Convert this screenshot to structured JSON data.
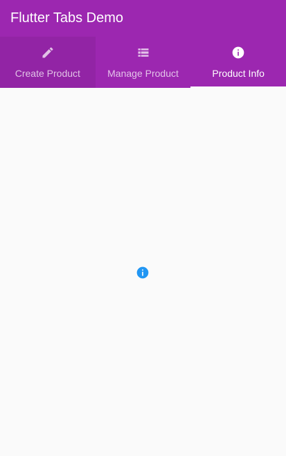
{
  "app": {
    "title": "Flutter Tabs Demo"
  },
  "tabs": [
    {
      "label": "Create Product",
      "icon": "pencil-icon",
      "selected": false
    },
    {
      "label": "Manage Product",
      "icon": "list-icon",
      "selected": false
    },
    {
      "label": "Product Info",
      "icon": "info-icon",
      "selected": true
    }
  ],
  "content": {
    "icon": "info-icon"
  },
  "colors": {
    "primary": "#9c27b0",
    "accent": "#2196f3",
    "background": "#fafafa"
  }
}
